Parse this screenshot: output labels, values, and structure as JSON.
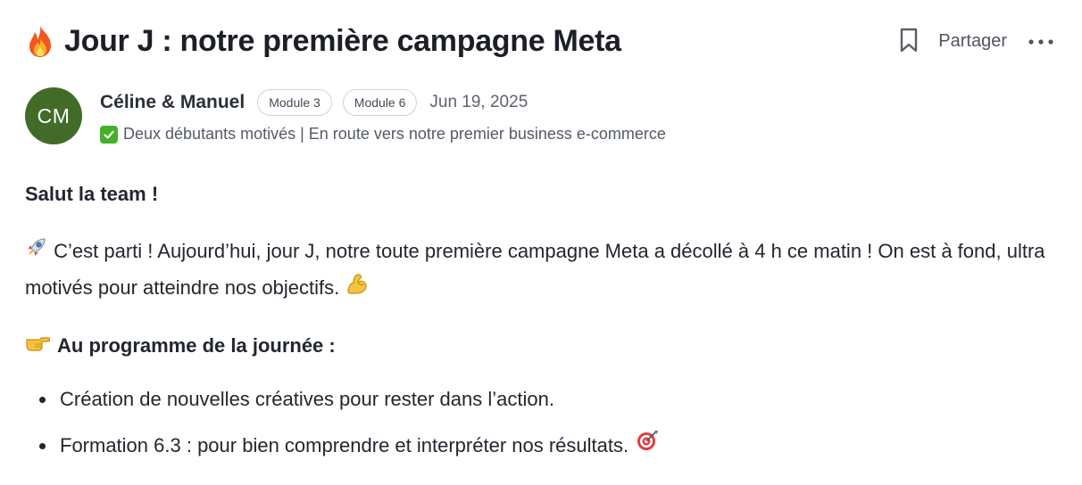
{
  "post": {
    "title": "Jour J : notre première campagne Meta",
    "title_icon": "fire-icon",
    "actions": {
      "bookmark_icon": "bookmark-icon",
      "share_label": "Partager",
      "more_icon": "more-horizontal-icon"
    }
  },
  "author": {
    "initials": "CM",
    "avatar_color": "#426b28",
    "name": "Céline & Manuel",
    "badges": [
      "Module 3",
      "Module 6"
    ],
    "date": "Jun 19, 2025",
    "bio_icon": "check-icon",
    "bio": "Deux débutants motivés | En route vers notre premier business e-commerce"
  },
  "body": {
    "greeting": "Salut la team !",
    "paragraph_icon": "rocket-icon",
    "paragraph": "C’est parti ! Aujourd’hui, jour J, notre toute première campagne Meta a décollé à 4 h ce matin ! On est à fond, ultra motivés pour atteindre nos objectifs.",
    "paragraph_end_icon": "flexed-biceps-icon",
    "section_icon": "pointing-hand-icon",
    "section_heading": "Au programme de la journée :",
    "bullets": [
      "Création de nouvelles créatives pour rester dans l’action.",
      "Formation 6.3 : pour bien comprendre et interpréter nos résultats."
    ],
    "bullet_end_icon": "target-icon"
  }
}
